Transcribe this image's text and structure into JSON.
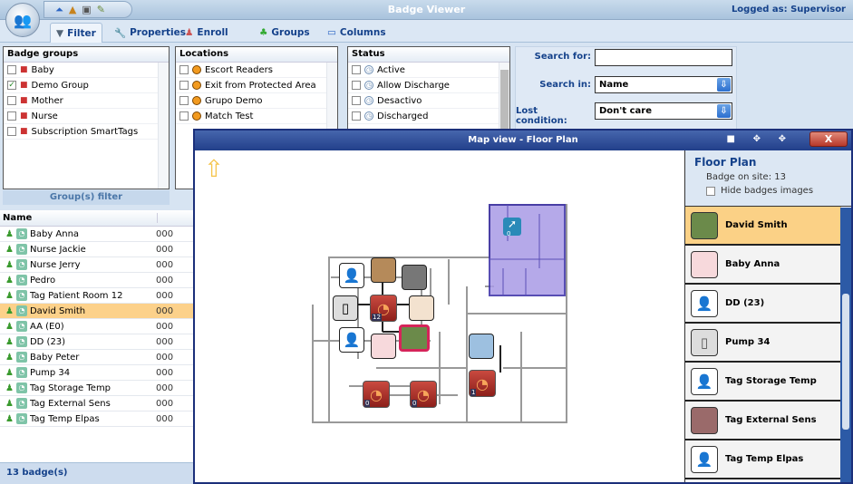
{
  "app": {
    "title": "Badge Viewer",
    "logged_as": "Logged as: Supervisor"
  },
  "tabs": [
    {
      "label": "Filter",
      "icon": "funnel-icon"
    },
    {
      "label": "Properties",
      "icon": "wrench-icon"
    },
    {
      "label": "Enroll",
      "icon": "enroll-icon"
    },
    {
      "label": "Groups",
      "icon": "groups-icon"
    },
    {
      "label": "Columns",
      "icon": "columns-icon"
    }
  ],
  "badge_groups": {
    "title": "Badge groups",
    "footer": "Group(s) filter",
    "items": [
      {
        "label": "Baby",
        "checked": false
      },
      {
        "label": "Demo Group",
        "checked": true
      },
      {
        "label": "Mother",
        "checked": false
      },
      {
        "label": "Nurse",
        "checked": false
      },
      {
        "label": "Subscription SmartTags",
        "checked": false
      }
    ]
  },
  "locations": {
    "title": "Locations",
    "items": [
      "Escort Readers",
      "Exit from Protected Area",
      "Grupo Demo",
      "Match Test"
    ]
  },
  "status": {
    "title": "Status",
    "items": [
      "Active",
      "Allow Discharge",
      "Desactivo",
      "Discharged"
    ]
  },
  "search": {
    "search_for_label": "Search for:",
    "search_for_value": "",
    "search_in_label": "Search in:",
    "search_in_value": "Name",
    "lost_label": "Lost condition:",
    "lost_value": "Don't care"
  },
  "list": {
    "header": "Name",
    "selected": "David Smith",
    "footer": "13 badge(s)",
    "rows": [
      {
        "name": "Baby Anna",
        "code": "000"
      },
      {
        "name": "Nurse Jackie",
        "code": "000"
      },
      {
        "name": "Nurse Jerry",
        "code": "000"
      },
      {
        "name": "Pedro",
        "code": "000"
      },
      {
        "name": "Tag Patient Room 12",
        "code": "000"
      },
      {
        "name": "David Smith",
        "code": "000"
      },
      {
        "name": "AA (E0)",
        "code": "000"
      },
      {
        "name": "DD (23)",
        "code": "000"
      },
      {
        "name": "Baby Peter",
        "code": "000"
      },
      {
        "name": "Pump 34",
        "code": "000"
      },
      {
        "name": "Tag Storage Temp",
        "code": "000"
      },
      {
        "name": "Tag External Sens",
        "code": "000"
      },
      {
        "name": "Tag Temp Elpas",
        "code": "000"
      }
    ]
  },
  "map": {
    "title": "Map view - Floor Plan",
    "close": "X",
    "panel_title": "Floor Plan",
    "badge_on_site": "Badge on site: 13",
    "hide_images_label": "Hide badges images",
    "hide_images_checked": false,
    "reader_counts": [
      "12",
      "0",
      "0",
      "1"
    ],
    "zone_count": "0",
    "badges": [
      {
        "name": "David Smith",
        "icon": "photo-man"
      },
      {
        "name": "Baby Anna",
        "icon": "photo-baby"
      },
      {
        "name": "DD (23)",
        "icon": "person-icon"
      },
      {
        "name": "Pump 34",
        "icon": "pump-icon"
      },
      {
        "name": "Tag Storage Temp",
        "icon": "person-icon"
      },
      {
        "name": "Tag External Sens",
        "icon": "photo-device"
      },
      {
        "name": "Tag Temp Elpas",
        "icon": "person-icon"
      }
    ]
  },
  "colors": {
    "selected": "#fcd18a",
    "accent": "#15428b",
    "zone": "#a99be6",
    "reader": "#b03a30"
  }
}
